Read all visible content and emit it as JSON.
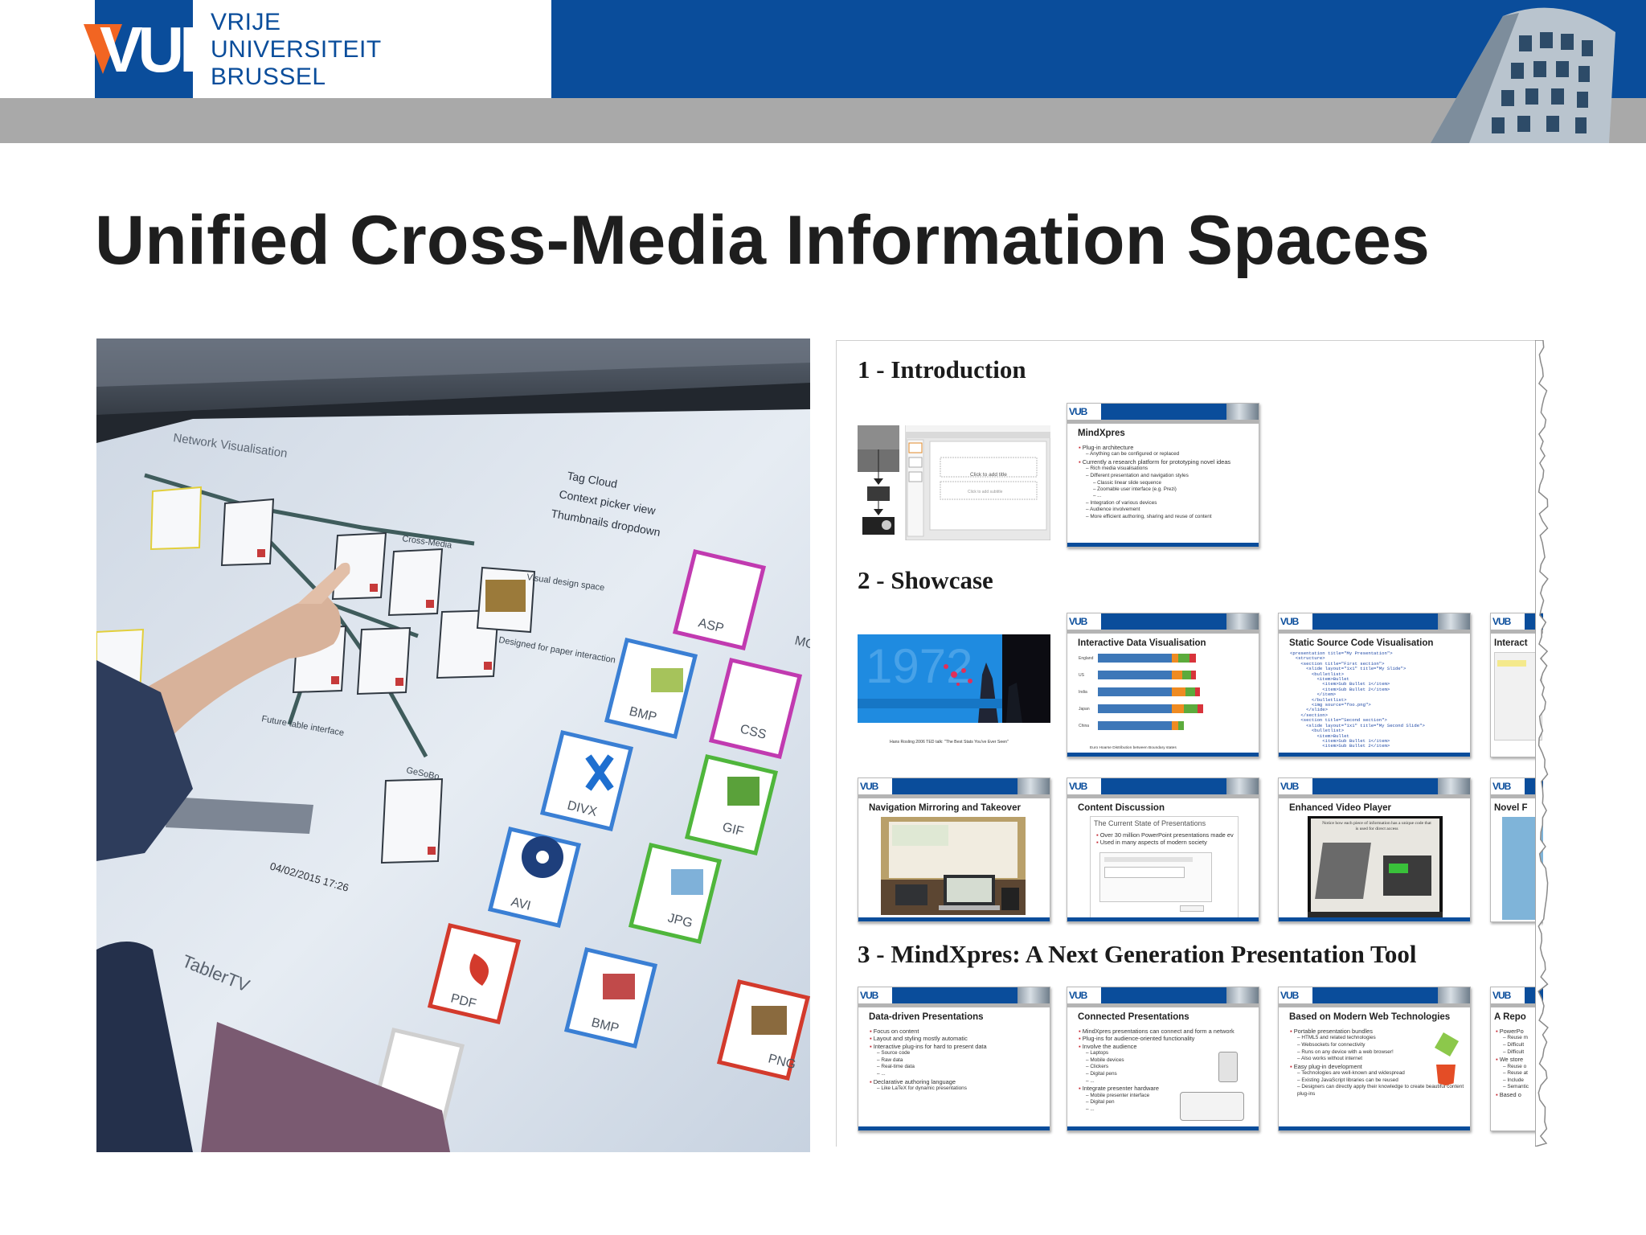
{
  "header": {
    "logo_letters": "VUB",
    "university_lines": [
      "VRIJE",
      "UNIVERSITEIT",
      "BRUSSEL"
    ],
    "colors": {
      "brand_blue": "#0a4d9b",
      "band_grey": "#a9a9a9",
      "logo_orange": "#f26522"
    }
  },
  "slide": {
    "title": "Unified Cross-Media Information Spaces"
  },
  "photo": {
    "screen_title": "Network Visualisation",
    "menu_items": [
      "Tag Cloud",
      "Context picker view",
      "Thumbnails dropdown"
    ],
    "node_labels": [
      "Visual design space",
      "Designed for paper interaction",
      "Cross-Media",
      "GeSoBo",
      "Future table interface"
    ],
    "timestamp": "04/02/2015 17:26",
    "bezel_label": "TablerTV",
    "file_icons": [
      "ASP",
      "BMP",
      "CSS",
      "DIVX",
      "GIF",
      "AVI",
      "JPG",
      "PDF",
      "BMP",
      "PNG",
      "MOV"
    ]
  },
  "overview": {
    "sections": [
      "1 - Introduction",
      "2 - Showcase",
      "3 - MindXpres: A Next Generation Presentation Tool"
    ],
    "intro": {
      "placeholder_title": "Click to add title",
      "placeholder_sub": "Click to add subtitle",
      "mindxpres_title": "MindXpres",
      "mindxpres_bullets": [
        {
          "lvl": 1,
          "text": "Plug-in architecture"
        },
        {
          "lvl": 2,
          "text": "Anything can be configured or replaced"
        },
        {
          "lvl": 1,
          "text": "Currently a research platform for prototyping novel ideas"
        },
        {
          "lvl": 2,
          "text": "Rich media visualisations"
        },
        {
          "lvl": 2,
          "text": "Different presentation and navigation styles"
        },
        {
          "lvl": 3,
          "text": "Classic linear slide sequence"
        },
        {
          "lvl": 3,
          "text": "Zoomable user interface (e.g. Prezi)"
        },
        {
          "lvl": 3,
          "text": "..."
        },
        {
          "lvl": 2,
          "text": "Integration of various devices"
        },
        {
          "lvl": 2,
          "text": "Audience involvement"
        },
        {
          "lvl": 2,
          "text": "More efficient authoring, sharing and reuse of content"
        }
      ]
    },
    "showcase": {
      "photo_caption": "Hans Rosling 2006 TED talk: \"The Best Stats You've Ever Seen\"",
      "data_vis_title": "Interactive Data Visualisation",
      "data_vis_rows": [
        "England",
        "US",
        "India",
        "Japan",
        "China"
      ],
      "data_vis_values": [
        [
          0.54,
          0.05,
          0.08,
          0.05
        ],
        [
          0.54,
          0.08,
          0.06,
          0.04
        ],
        [
          0.54,
          0.1,
          0.07,
          0.04
        ],
        [
          0.54,
          0.09,
          0.1,
          0.04
        ],
        [
          0.54,
          0.05,
          0.04,
          0.0
        ]
      ],
      "data_vis_footer": "Euro Hoarse Distribution between Boundary states",
      "code_vis_title": "Static Source Code Visualisation",
      "code_lines": [
        "<presentation title=\"My Presentation\">",
        "  <structure>",
        "    <section title=\"First section\">",
        "      <slide layout=\"1x1\" title=\"My Slide\">",
        "        <bulletlist>",
        "          <item>Bullet",
        "            <item>Sub Bullet 1</item>",
        "            <item>Sub Bullet 2</item>",
        "          </item>",
        "        </bulletlist>",
        "        <img source=\"foo.png\">",
        "      </slide>",
        "    </section>",
        "    <section title=\"Second section\">",
        "      <slide layout=\"1x1\" title=\"My Second Slide\">",
        "        <bulletlist>",
        "          <item>Bullet",
        "            <item>Sub Bullet 1</item>",
        "            <item>Sub Bullet 2</item>"
      ],
      "interact_title": "Interact",
      "nav_title": "Navigation Mirroring and Takeover",
      "discussion_title": "Content Discussion",
      "discussion_sub": "The Current State of Presentations",
      "discussion_bullets": [
        "Over 30 million PowerPoint presentations made ev",
        "Used in many aspects of modern society"
      ],
      "video_title": "Enhanced Video Player",
      "video_text": "Notice how each piece of information has a unique code that is used for direct access",
      "novel_title": "Novel F"
    },
    "mindxpres": {
      "data_driven_title": "Data-driven Presentations",
      "data_driven_bullets": [
        {
          "lvl": 1,
          "text": "Focus on content"
        },
        {
          "lvl": 1,
          "text": "Layout and styling mostly automatic"
        },
        {
          "lvl": 1,
          "text": "Interactive plug-ins for hard to present data"
        },
        {
          "lvl": 2,
          "text": "Source code"
        },
        {
          "lvl": 2,
          "text": "Raw data"
        },
        {
          "lvl": 2,
          "text": "Real-time data"
        },
        {
          "lvl": 2,
          "text": "..."
        },
        {
          "lvl": 1,
          "text": "Declarative authoring language"
        },
        {
          "lvl": 2,
          "text": "Like LaTeX for dynamic presentations"
        }
      ],
      "connected_title": "Connected Presentations",
      "connected_bullets": [
        {
          "lvl": 1,
          "text": "MindXpres presentations can connect and form a network"
        },
        {
          "lvl": 1,
          "text": "Plug-ins for audience-oriented functionality"
        },
        {
          "lvl": 1,
          "text": "Involve the audience"
        },
        {
          "lvl": 2,
          "text": "Laptops"
        },
        {
          "lvl": 2,
          "text": "Mobile devices"
        },
        {
          "lvl": 2,
          "text": "Clickers"
        },
        {
          "lvl": 2,
          "text": "Digital pens"
        },
        {
          "lvl": 2,
          "text": "..."
        },
        {
          "lvl": 1,
          "text": "Integrate presenter hardware"
        },
        {
          "lvl": 2,
          "text": "Mobile presenter interface"
        },
        {
          "lvl": 2,
          "text": "Digital pen"
        },
        {
          "lvl": 2,
          "text": "..."
        }
      ],
      "modern_title": "Based on Modern Web Technologies",
      "modern_bullets": [
        {
          "lvl": 1,
          "text": "Portable presentation bundles"
        },
        {
          "lvl": 2,
          "text": "HTML5 and related technologies"
        },
        {
          "lvl": 2,
          "text": "Websockets for connectivity"
        },
        {
          "lvl": 2,
          "text": "Runs on any device with a web browser!"
        },
        {
          "lvl": 2,
          "text": "Also works without internet"
        },
        {
          "lvl": 1,
          "text": "Easy plug-in development"
        },
        {
          "lvl": 2,
          "text": "Technologies are well-known and widespread"
        },
        {
          "lvl": 2,
          "text": "Existing JavaScript libraries can be reused"
        },
        {
          "lvl": 2,
          "text": "Designers can directly apply their knowledge to create beautiful content plug-ins"
        }
      ],
      "repo_title": "A Repo",
      "repo_bullets": [
        {
          "lvl": 1,
          "text": "PowerPo"
        },
        {
          "lvl": 2,
          "text": "Reuse m"
        },
        {
          "lvl": 2,
          "text": "Difficult"
        },
        {
          "lvl": 2,
          "text": "Difficult"
        },
        {
          "lvl": 1,
          "text": "We store"
        },
        {
          "lvl": 2,
          "text": "Reuse o"
        },
        {
          "lvl": 2,
          "text": "Reuse at"
        },
        {
          "lvl": 2,
          "text": "Include"
        },
        {
          "lvl": 2,
          "text": "Semantic"
        },
        {
          "lvl": 1,
          "text": "Based o"
        }
      ]
    }
  }
}
